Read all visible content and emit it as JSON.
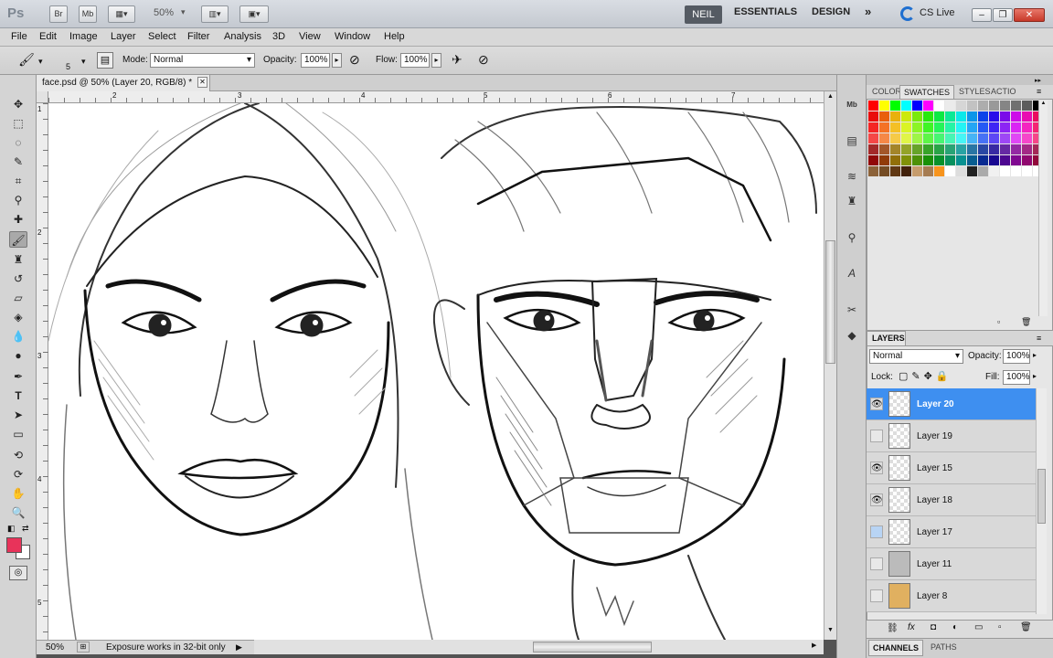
{
  "titlebar": {
    "app_logo": "Ps",
    "br_label": "Br",
    "mb_label": "Mb",
    "zoom": "50%",
    "workspaces": {
      "active": "NEIL",
      "essentials": "ESSENTIALS",
      "design": "DESIGN",
      "more": "»"
    },
    "cs_live": "CS Live"
  },
  "menu": [
    "File",
    "Edit",
    "Image",
    "Layer",
    "Select",
    "Filter",
    "Analysis",
    "3D",
    "View",
    "Window",
    "Help"
  ],
  "options": {
    "brush_size": "5",
    "mode_label": "Mode:",
    "mode_value": "Normal",
    "opacity_label": "Opacity:",
    "opacity_value": "100%",
    "flow_label": "Flow:",
    "flow_value": "100%"
  },
  "document": {
    "tab_title": "face.psd @ 50% (Layer 20, RGB/8) *"
  },
  "ruler": {
    "h_ticks": [
      "2",
      "3",
      "4",
      "5",
      "6",
      "7"
    ],
    "v_ticks": [
      "1",
      "2",
      "3",
      "4",
      "5"
    ]
  },
  "status": {
    "zoom": "50%",
    "message": "Exposure works in 32-bit only"
  },
  "panels": {
    "swatches_tabs": [
      "COLOR",
      "SWATCHES",
      "STYLES",
      "ACTIO"
    ],
    "layers_title": "LAYERS",
    "blend_mode": "Normal",
    "opacity_label": "Opacity:",
    "opacity_value": "100%",
    "lock_label": "Lock:",
    "fill_label": "Fill:",
    "fill_value": "100%",
    "layers": [
      {
        "name": "Layer 20",
        "visible": true,
        "selected": true
      },
      {
        "name": "Layer 19",
        "visible": false,
        "selected": false
      },
      {
        "name": "Layer 15",
        "visible": true,
        "selected": false
      },
      {
        "name": "Layer 18",
        "visible": true,
        "selected": false
      },
      {
        "name": "Layer 17",
        "visible": false,
        "selected": false
      },
      {
        "name": "Layer 11",
        "visible": false,
        "selected": false
      },
      {
        "name": "Layer 8",
        "visible": false,
        "selected": false
      }
    ],
    "bottom_tabs": [
      "CHANNELS",
      "PATHS"
    ]
  },
  "colors": {
    "foreground": "#e8335a",
    "background": "#ffffff",
    "selection": "#3e8ff0"
  }
}
